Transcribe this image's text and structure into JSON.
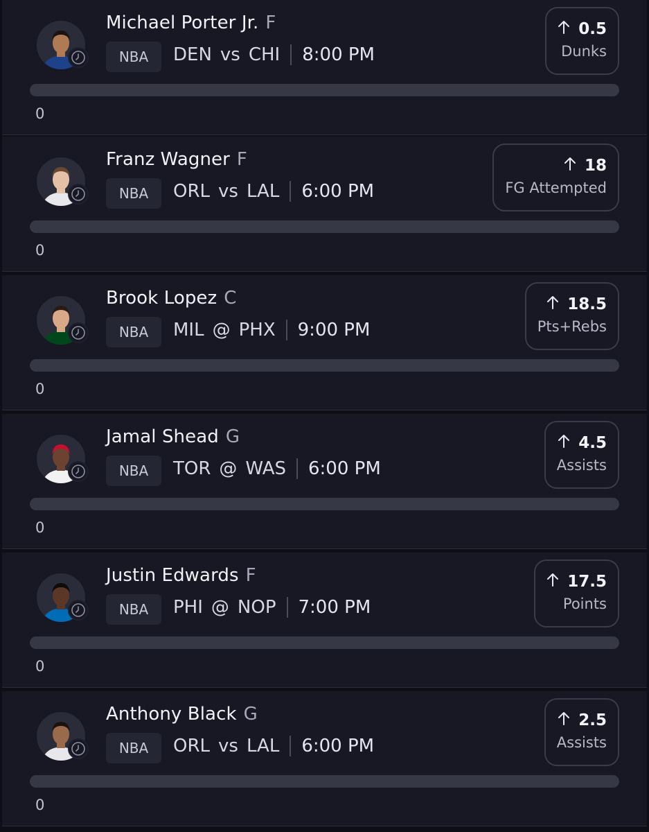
{
  "picks": [
    {
      "player": "Michael Porter Jr.",
      "position": "F",
      "league": "NBA",
      "team": "DEN",
      "sep": "vs",
      "opponent": "CHI",
      "time": "8:00 PM",
      "line": "0.5",
      "stat": "Dunks",
      "progress_value": "0",
      "progress_fraction": 0,
      "jersey_color": "#1d428a",
      "skin_color": "#b07a55",
      "hair_color": "#1a1410"
    },
    {
      "player": "Franz Wagner",
      "position": "F",
      "league": "NBA",
      "team": "ORL",
      "sep": "vs",
      "opponent": "LAL",
      "time": "6:00 PM",
      "line": "18",
      "stat": "FG Attempted",
      "progress_value": "0",
      "progress_fraction": 0,
      "jersey_color": "#e8e8ec",
      "skin_color": "#e4c1a6",
      "hair_color": "#6a4a2e"
    },
    {
      "player": "Brook Lopez",
      "position": "C",
      "league": "NBA",
      "team": "MIL",
      "sep": "@",
      "opponent": "PHX",
      "time": "9:00 PM",
      "line": "18.5",
      "stat": "Pts+Rebs",
      "progress_value": "0",
      "progress_fraction": 0,
      "jersey_color": "#00471b",
      "skin_color": "#d9a888",
      "hair_color": "#2a1c14"
    },
    {
      "player": "Jamal Shead",
      "position": "G",
      "league": "NBA",
      "team": "TOR",
      "sep": "@",
      "opponent": "WAS",
      "time": "6:00 PM",
      "line": "4.5",
      "stat": "Assists",
      "progress_value": "0",
      "progress_fraction": 0,
      "jersey_color": "#f2f2f2",
      "skin_color": "#6b4330",
      "hair_color": "#c8102e"
    },
    {
      "player": "Justin Edwards",
      "position": "F",
      "league": "NBA",
      "team": "PHI",
      "sep": "@",
      "opponent": "NOP",
      "time": "7:00 PM",
      "line": "17.5",
      "stat": "Points",
      "progress_value": "0",
      "progress_fraction": 0,
      "jersey_color": "#006bb6",
      "skin_color": "#5a3726",
      "hair_color": "#0f0b09"
    },
    {
      "player": "Anthony Black",
      "position": "G",
      "league": "NBA",
      "team": "ORL",
      "sep": "vs",
      "opponent": "LAL",
      "time": "6:00 PM",
      "line": "2.5",
      "stat": "Assists",
      "progress_value": "0",
      "progress_fraction": 0,
      "jersey_color": "#e8e8ec",
      "skin_color": "#9a6a4c",
      "hair_color": "#1b120d"
    }
  ],
  "icons": {
    "avatar": "player-headshot-icon",
    "status": "clock-icon",
    "direction": "arrow-up-icon"
  },
  "colors": {
    "background": "#0e0f16",
    "card": "#171823",
    "badge": "#242634",
    "track": "#363846"
  }
}
